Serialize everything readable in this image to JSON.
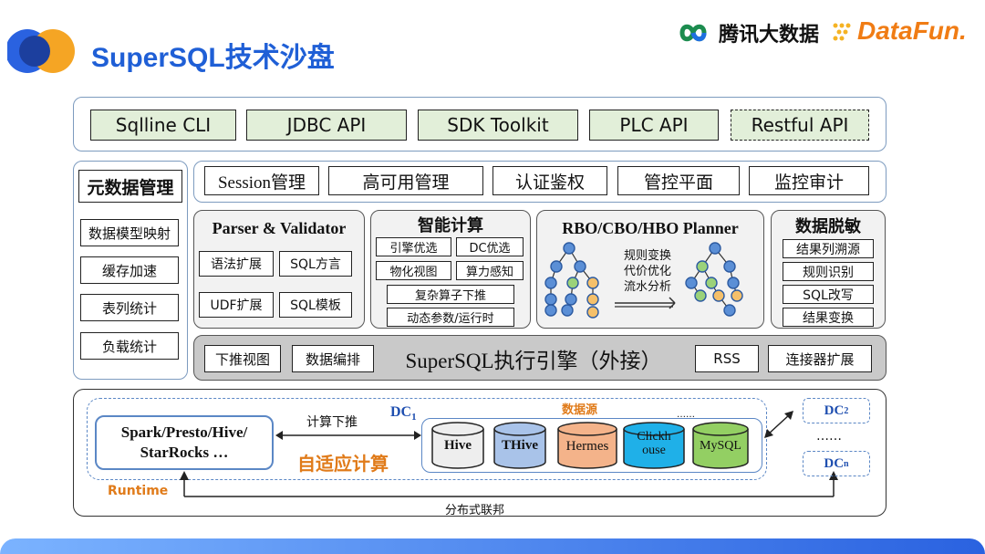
{
  "header": {
    "title": "SuperSQL技术沙盘",
    "brand_tencent": "腾讯大数据",
    "brand_datafun": "DataFun."
  },
  "top_row": [
    "Sqlline CLI",
    "JDBC API",
    "SDK Toolkit",
    "PLC API",
    "Restful API"
  ],
  "metadata": {
    "title": "元数据管理",
    "items": [
      "数据模型映射",
      "缓存加速",
      "表列统计",
      "负载统计"
    ]
  },
  "services": [
    "Session管理",
    "高可用管理",
    "认证鉴权",
    "管控平面",
    "监控审计"
  ],
  "parser": {
    "title": "Parser & Validator",
    "items": [
      "语法扩展",
      "SQL方言",
      "UDF扩展",
      "SQL模板"
    ]
  },
  "smart": {
    "title": "智能计算",
    "items": [
      "引擎优选",
      "DC优选",
      "物化视图",
      "算力感知",
      "复杂算子下推",
      "动态参数/运行时"
    ]
  },
  "planner": {
    "title": "RBO/CBO/HBO Planner",
    "text": [
      "规则变换",
      "代价优化",
      "流水分析"
    ]
  },
  "masking": {
    "title": "数据脱敏",
    "items": [
      "结果列溯源",
      "规则识别",
      "SQL改写",
      "结果变换"
    ]
  },
  "engine": {
    "left": [
      "下推视图",
      "数据编排"
    ],
    "title": "SuperSQL执行引擎（外接）",
    "right": [
      "RSS",
      "连接器扩展"
    ]
  },
  "runtime": {
    "engines": "Spark/Presto/Hive/\nStarRocks …",
    "push_label": "计算下推",
    "dc1_main": "DC",
    "dc1_sub": "1",
    "adaptive": "自适应计算",
    "datasource_label": "数据源",
    "ellipsis_top": "……",
    "sources": [
      "Hive",
      "THive",
      "Hermes",
      "Clickh\nouse",
      "MySQL"
    ],
    "runtime_label": "Runtime",
    "federation": "分布式联邦",
    "dc2_main": "DC",
    "dc2_sub": "2",
    "dc_ellipsis": "……",
    "dcn_main": "DC",
    "dcn_sub": "n"
  },
  "colors": {
    "title_blue": "#1f5fd6",
    "green_fill": "#e2efd9",
    "orange": "#e07b1a",
    "hive_fill": "#eeeeee",
    "thive_fill": "#a9c3e9",
    "hermes_fill": "#f4b38a",
    "clickhouse_fill": "#1fb0e8",
    "mysql_fill": "#93cf63",
    "node_blue": "#5b8fd6",
    "node_green": "#9bd27a",
    "node_orange": "#f5c06a"
  }
}
